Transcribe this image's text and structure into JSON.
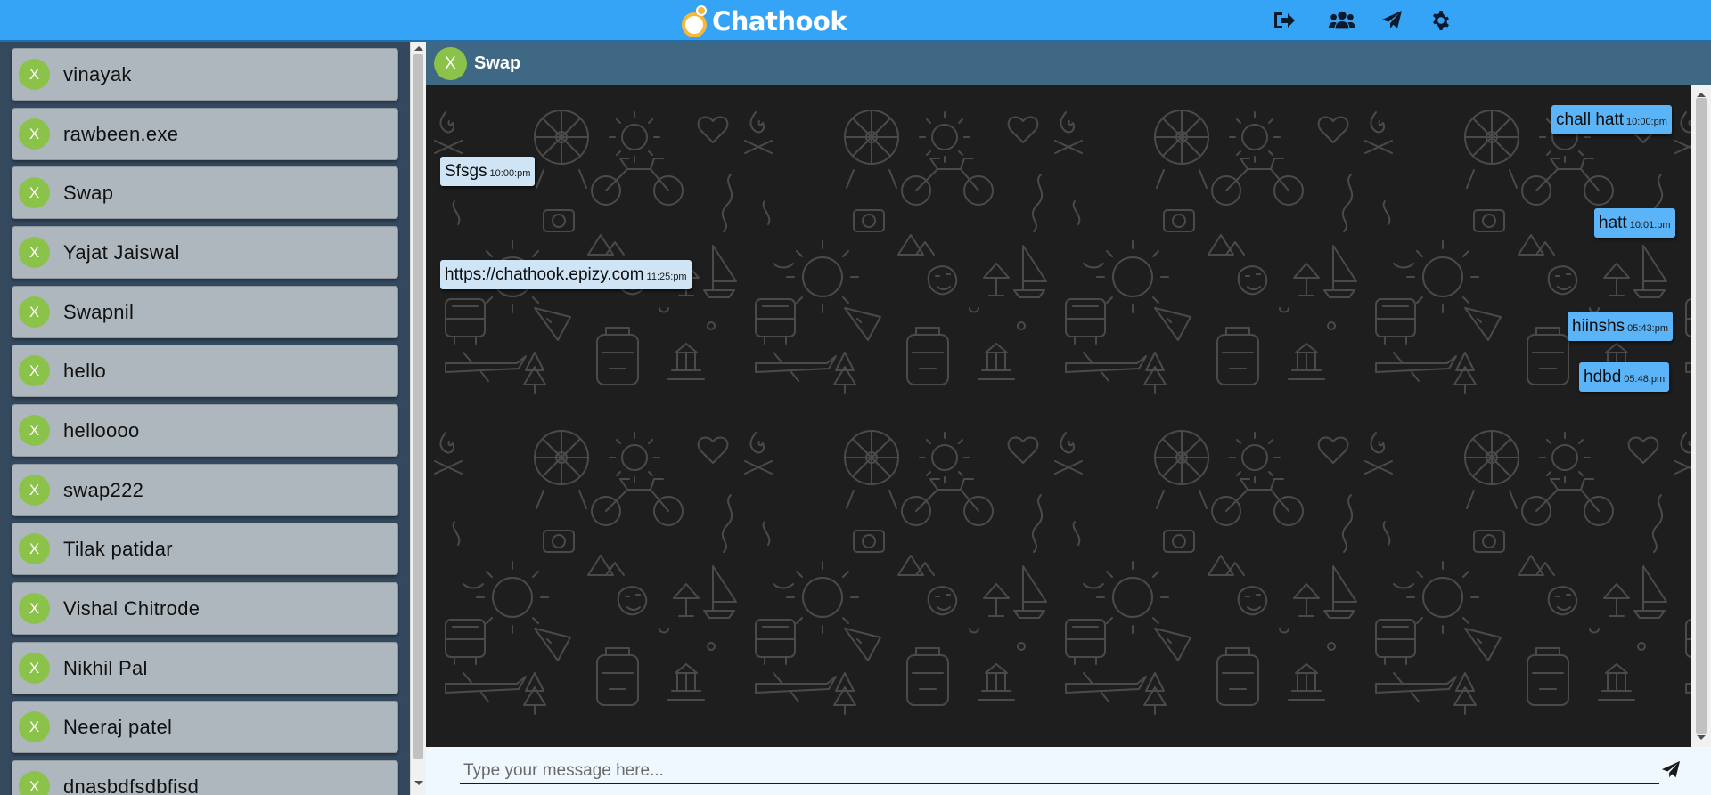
{
  "app": {
    "name": "Chathook"
  },
  "topbar": {
    "icons": [
      "logout-icon",
      "group-icon",
      "send-plane-icon",
      "settings-gear-icon"
    ],
    "brand_color": "#35a4f7",
    "accent_color": "#f5b83a"
  },
  "contacts": [
    {
      "avatar": "X",
      "name": "vinayak"
    },
    {
      "avatar": "X",
      "name": "rawbeen.exe"
    },
    {
      "avatar": "X",
      "name": "Swap"
    },
    {
      "avatar": "X",
      "name": "Yajat Jaiswal"
    },
    {
      "avatar": "X",
      "name": "Swapnil"
    },
    {
      "avatar": "X",
      "name": "hello"
    },
    {
      "avatar": "X",
      "name": "helloooo"
    },
    {
      "avatar": "X",
      "name": "swap222"
    },
    {
      "avatar": "X",
      "name": "Tilak patidar"
    },
    {
      "avatar": "X",
      "name": "Vishal Chitrode"
    },
    {
      "avatar": "X",
      "name": "Nikhil Pal"
    },
    {
      "avatar": "X",
      "name": "Neeraj patel"
    },
    {
      "avatar": "X",
      "name": "dnasbdfsdbfisd"
    }
  ],
  "chat": {
    "avatar": "X",
    "title": "Swap",
    "messages": [
      {
        "direction": "out",
        "text": "chall hatt",
        "time": "10:00:pm"
      },
      {
        "direction": "in",
        "text": "Sfsgs",
        "time": "10:00:pm"
      },
      {
        "direction": "out",
        "text": "hatt",
        "time": "10:01:pm"
      },
      {
        "direction": "in",
        "text": "https://chathook.epizy.com",
        "time": "11:25:pm"
      },
      {
        "direction": "out",
        "text": "hiinshs",
        "time": "05:43:pm"
      },
      {
        "direction": "out",
        "text": "hdbd",
        "time": "05:48:pm"
      }
    ]
  },
  "composer": {
    "placeholder": "Type your message here...",
    "value": ""
  }
}
